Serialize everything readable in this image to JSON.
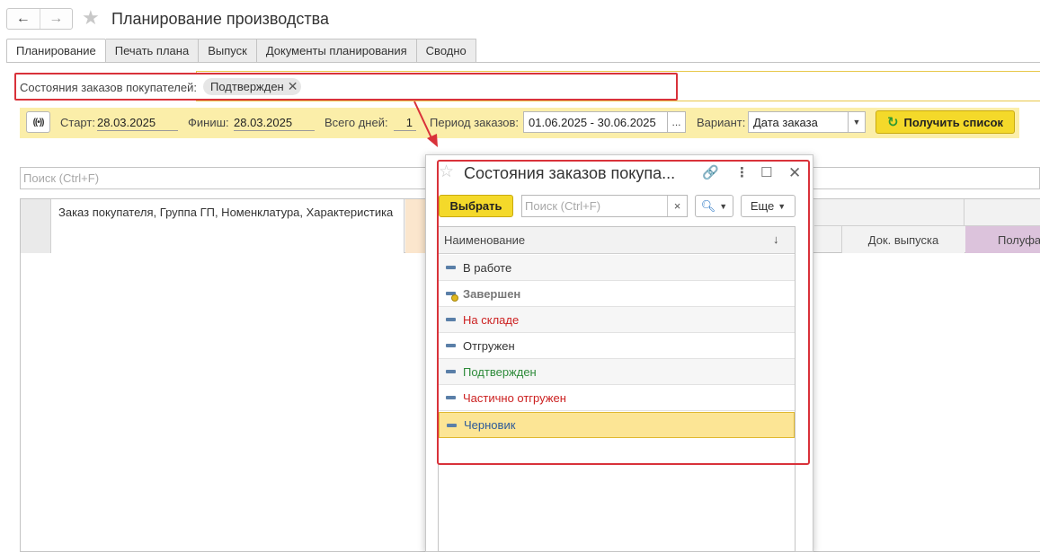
{
  "window": {
    "title": "Планирование производства"
  },
  "nav": {
    "back_icon": "arrow-left-icon",
    "forward_icon": "arrow-right-icon",
    "favorite_icon": "star-icon"
  },
  "tabs": [
    {
      "label": "Планирование",
      "active": true
    },
    {
      "label": "Печать плана",
      "active": false
    },
    {
      "label": "Выпуск",
      "active": false
    },
    {
      "label": "Документы планирования",
      "active": false
    },
    {
      "label": "Сводно",
      "active": false
    }
  ],
  "filter": {
    "label": "Состояния заказов покупателей:",
    "chip": "Подтвержден",
    "chip_remove": "✕"
  },
  "params": {
    "start_label": "Старт:",
    "start_value": "28.03.2025",
    "finish_label": "Финиш:",
    "finish_value": "28.03.2025",
    "days_label": "Всего дней:",
    "days_value": "1",
    "period_label": "Период заказов:",
    "period_value": "01.06.2025 - 30.06.2025",
    "period_btn": "...",
    "variant_label": "Вариант:",
    "variant_value": "Дата заказа",
    "get_list_label": "Получить список"
  },
  "main_search": {
    "placeholder": "Поиск (Ctrl+F)"
  },
  "grid": {
    "main_column": "Заказ покупателя, Группа ГП, Номенклатура, Характеристика",
    "doc_column": "Док. выпуска",
    "semi_column": "Полуфа"
  },
  "popup": {
    "title": "Состояния заказов покупа...",
    "select_label": "Выбрать",
    "search_placeholder": "Поиск (Ctrl+F)",
    "search_clear": "×",
    "more_label": "Еще",
    "column_name": "Наименование",
    "sort_indicator": "↓",
    "items": [
      {
        "label": "В работе",
        "color": "#333333",
        "bold": false,
        "icon": "item-dash-icon"
      },
      {
        "label": "Завершен",
        "color": "#777777",
        "bold": true,
        "icon": "item-done-icon"
      },
      {
        "label": "На складе",
        "color": "#cc1f1f",
        "bold": false,
        "icon": "item-dash-icon"
      },
      {
        "label": "Отгружен",
        "color": "#333333",
        "bold": false,
        "icon": "item-dash-icon"
      },
      {
        "label": "Подтвержден",
        "color": "#2e8b3a",
        "bold": false,
        "icon": "item-dash-icon"
      },
      {
        "label": "Частично отгружен",
        "color": "#cc1f1f",
        "bold": false,
        "icon": "item-dash-icon"
      },
      {
        "label": "Черновик",
        "color": "#2d5a9a",
        "bold": false,
        "icon": "item-dash-icon",
        "selected": true
      }
    ]
  },
  "colors": {
    "accent_yellow": "#f4d92a",
    "highlight_red": "#d9323a",
    "param_bar": "#fbeea9"
  }
}
